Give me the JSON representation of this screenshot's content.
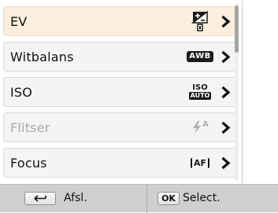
{
  "menu": {
    "items": [
      {
        "label": "EV",
        "icon": "exposure-value-icon",
        "enabled": true,
        "selected": true
      },
      {
        "label": "Witbalans",
        "icon": "awb-icon",
        "icon_text": "AWB",
        "enabled": true
      },
      {
        "label": "ISO",
        "icon": "iso-auto-icon",
        "icon_text_top": "ISO",
        "icon_text_bottom": "AUTO",
        "enabled": true
      },
      {
        "label": "Flitser",
        "icon": "flash-auto-icon",
        "icon_text": "A",
        "enabled": false
      },
      {
        "label": "Focus",
        "icon": "af-icon",
        "icon_text": "AF",
        "enabled": true
      }
    ]
  },
  "bottom_bar": {
    "back_label": "Afsl.",
    "back_icon": "return-arrow-icon",
    "ok_key": "OK",
    "select_label": "Select."
  },
  "colors": {
    "selected_item": "#fbeedd",
    "item_background": "#f4f4f4",
    "disabled_text": "#a9a9a9",
    "bar_background": "#cfcfcf"
  }
}
